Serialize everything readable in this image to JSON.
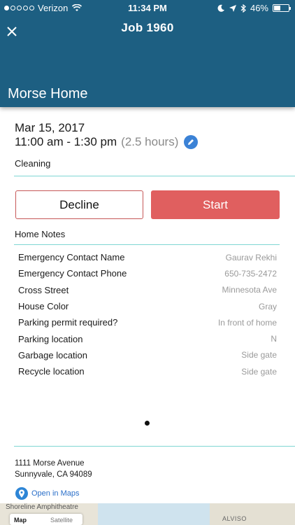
{
  "status_bar": {
    "carrier": "Verizon",
    "time": "11:34 PM",
    "battery": "46%",
    "battery_level": 0.46
  },
  "header": {
    "title": "Job 1960",
    "home_name": "Morse Home"
  },
  "job": {
    "date": "Mar 15, 2017",
    "time_range": "11:00 am - 1:30 pm",
    "duration": "(2.5 hours)",
    "service": "Cleaning"
  },
  "actions": {
    "decline": "Decline",
    "start": "Start"
  },
  "notes": {
    "title": "Home Notes",
    "rows": [
      {
        "label": "Emergency Contact Name",
        "value": "Gaurav Rekhi"
      },
      {
        "label": "Emergency Contact Phone",
        "value": "650-735-2472"
      },
      {
        "label": "Cross Street",
        "value": "Minnesota Ave"
      },
      {
        "label": "House Color",
        "value": "Gray"
      },
      {
        "label": "Parking permit required?",
        "value": "In front of home"
      },
      {
        "label": "Parking location",
        "value": "N"
      },
      {
        "label": "Garbage location",
        "value": "Side gate"
      },
      {
        "label": "Recycle location",
        "value": "Side gate"
      }
    ]
  },
  "address": {
    "line1": "1111 Morse Avenue",
    "line2": "Sunnyvale, CA 94089",
    "open_maps": "Open in Maps"
  },
  "map": {
    "label_shoreline": "Shoreline Amphitheatre",
    "label_alviso": "ALVISO",
    "toggle_map": "Map",
    "toggle_satellite": "Satellite"
  },
  "colors": {
    "header_bg": "#1d5f82",
    "accent_divider": "#7fd6d3",
    "start_button": "#e05f5f",
    "decline_border": "#c65757",
    "link": "#2a6fc9"
  }
}
